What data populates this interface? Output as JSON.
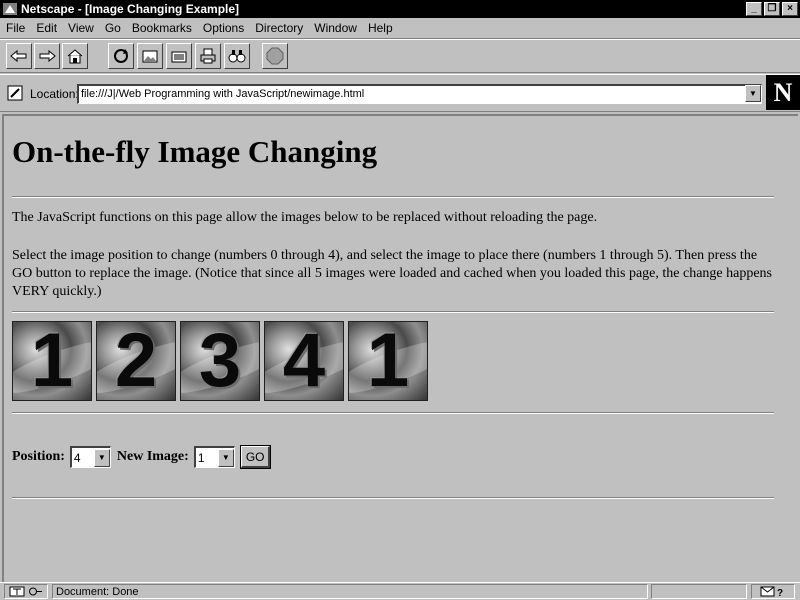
{
  "window": {
    "title": "Netscape - [Image Changing Example]"
  },
  "menu": [
    "File",
    "Edit",
    "View",
    "Go",
    "Bookmarks",
    "Options",
    "Directory",
    "Window",
    "Help"
  ],
  "toolbar": {
    "buttons": [
      "back-icon",
      "forward-icon",
      "home-icon",
      "reload-icon",
      "images-icon",
      "open-icon",
      "print-icon",
      "find-icon",
      "stop-icon"
    ]
  },
  "location": {
    "label": "Location:",
    "url": "file:///J|/Web Programming with JavaScript/newimage.html"
  },
  "brand": {
    "logo_letter": "N"
  },
  "page": {
    "title": "On-the-fly Image Changing",
    "para1": "The JavaScript functions on this page allow the images below to be replaced without reloading the page.",
    "para2": "Select the image position to change (numbers 0 through 4), and select the image to place there (numbers 1 through 5). Then press the GO button to replace the image. (Notice that since all 5 images were loaded and cached when you loaded this page, the change happens VERY quickly.)",
    "images": [
      "1",
      "2",
      "3",
      "4",
      "1"
    ],
    "form": {
      "position_label": "Position:",
      "position_value": "4",
      "newimage_label": "New Image:",
      "newimage_value": "1",
      "go_label": "GO"
    }
  },
  "status": {
    "text": "Document: Done"
  }
}
